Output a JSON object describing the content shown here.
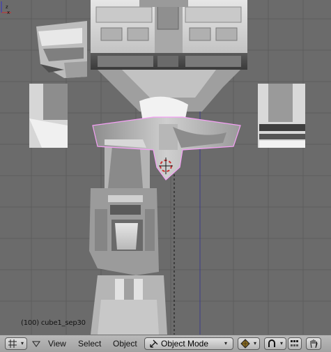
{
  "viewport": {
    "status_text": "(100) cube1_sep30",
    "axis_labels": {
      "x": "x",
      "z": "z"
    }
  },
  "header": {
    "menus": [
      "View",
      "Select",
      "Object"
    ],
    "mode_label": "Object Mode",
    "icons": [
      "editor-type-icon",
      "collapse-triangle-icon",
      "mode-icon",
      "draw-type-icon",
      "pivot-icon",
      "layers-icon",
      "hand-icon"
    ]
  },
  "colors": {
    "viewport_bg": "#6b6b6b",
    "grid_line": "#5e5e5e",
    "selected_outline": "#f5a0f5",
    "header_bg": "#a9a9a9"
  }
}
